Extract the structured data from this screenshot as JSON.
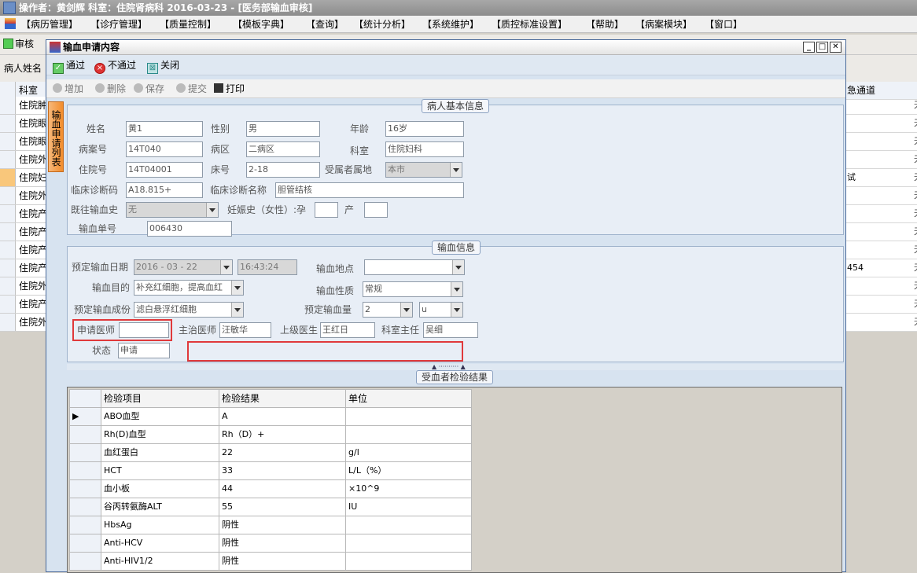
{
  "app": {
    "title": "操作者：黄剑辉   科室：住院肾病科   2016-03-23 - [医务部输血审核]"
  },
  "menu": [
    "【病历管理】",
    "【诊疗管理】",
    "【质量控制】",
    "【模板字典】",
    "【查询】",
    "【统计分析】",
    "【系统维护】",
    "【质控标准设置】",
    "【帮助】",
    "【病案模块】",
    "【窗口】"
  ],
  "background": {
    "audit_button": "审核",
    "patient_name_label": "病人姓名",
    "col_dept": "科室",
    "col_right": "急通道",
    "rows": [
      "住院肿",
      "住院眼",
      "住院眼",
      "住院外",
      "住院妇",
      "住院外",
      "住院产",
      "住院产",
      "住院产",
      "住院产",
      "住院外",
      "住院产",
      "住院外"
    ],
    "right_rows": [
      "",
      "",
      "",
      "",
      "试",
      "",
      "",
      "",
      "",
      "454",
      "",
      "",
      ""
    ],
    "right_col_glyph": "无"
  },
  "dialog": {
    "title": "输血申请内容",
    "toolbar1": {
      "pass": "通过",
      "fail": "不通过",
      "close": "关闭"
    },
    "toolbar2": {
      "add": "增加",
      "delete": "删除",
      "save": "保存",
      "submit": "提交",
      "print": "打印"
    },
    "side_tab": "输血申请列表"
  },
  "patient_info": {
    "title": "病人基本信息",
    "name_label": "姓名",
    "name": "黄1",
    "gender_label": "性别",
    "gender": "男",
    "age_label": "年龄",
    "age": "16岁",
    "record_no_label": "病案号",
    "record_no": "14T040",
    "ward_label": "病区",
    "ward": "二病区",
    "dept_label": "科室",
    "dept": "住院妇科",
    "inpatient_no_label": "住院号",
    "inpatient_no": "14T04001",
    "bed_label": "床号",
    "bed": "2-18",
    "residence_label": "受属者属地",
    "residence": "本市",
    "diag_code_label": "临床诊断码",
    "diag_code": "A18.815+",
    "diag_name_label": "临床诊断名称",
    "diag_name": "胆管结核",
    "history_label": "既往输血史",
    "history": "无",
    "pregnancy_label": "妊娠史（女性）:孕",
    "pregnancy": "",
    "birth_label": "产",
    "birth": "",
    "slip_no_label": "输血单号",
    "slip_no": "006430"
  },
  "transfusion_info": {
    "title": "输血信息",
    "date_label": "预定输血日期",
    "date": "2016 - 03 - 22",
    "time": "16:43:24",
    "place_label": "输血地点",
    "place": "",
    "purpose_label": "输血目的",
    "purpose": "补充红细胞，提高血红",
    "nature_label": "输血性质",
    "nature": "常规",
    "component_label": "预定输血成份",
    "component": "滤白悬浮红细胞",
    "amount_label": "预定输血量",
    "amount": "2",
    "unit": "u",
    "req_doctor_label": "申请医师",
    "req_doctor": "",
    "att_doctor_label": "主治医师",
    "att_doctor": "汪敏华",
    "sup_doctor_label": "上级医生",
    "sup_doctor": "王红日",
    "director_label": "科室主任",
    "director": "吴细",
    "status_label": "状态",
    "status": "申请"
  },
  "results": {
    "title": "受血者检验结果",
    "headers": [
      "检验项目",
      "检验结果",
      "单位"
    ],
    "rows": [
      [
        "ABO血型",
        "A",
        ""
      ],
      [
        "Rh(D)血型",
        "Rh（D）+",
        ""
      ],
      [
        "血红蛋白",
        "22",
        "g/l"
      ],
      [
        "HCT",
        "33",
        "L/L（%）"
      ],
      [
        "血小板",
        "44",
        "×10^9"
      ],
      [
        "谷丙转氨酶ALT",
        "55",
        "IU"
      ],
      [
        "HbsAg",
        "阴性",
        ""
      ],
      [
        "Anti-HCV",
        "阴性",
        ""
      ],
      [
        "Anti-HIV1/2",
        "阴性",
        ""
      ]
    ]
  }
}
